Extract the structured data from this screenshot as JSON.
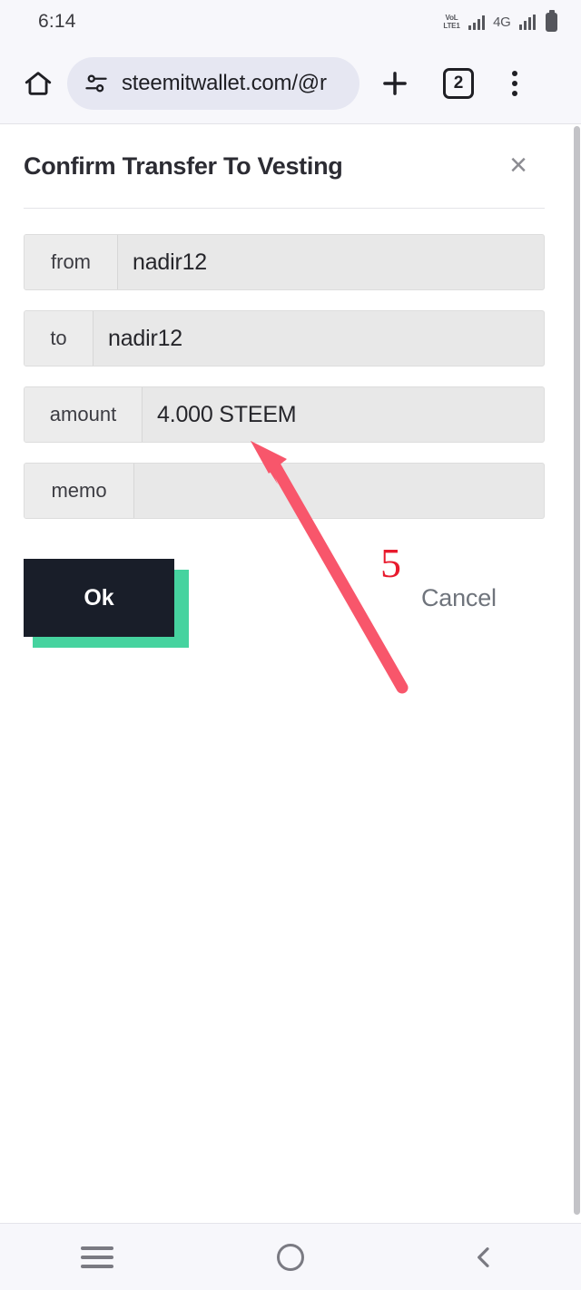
{
  "status_bar": {
    "time": "6:14",
    "volte_line1": "VoL",
    "volte_line2": "LTE1",
    "network": "4G"
  },
  "browser": {
    "url": "steemitwallet.com/@r",
    "tab_count": "2"
  },
  "dialog": {
    "title": "Confirm Transfer To Vesting",
    "close_label": "×",
    "fields": [
      {
        "label": "from",
        "value": "nadir12"
      },
      {
        "label": "to",
        "value": "nadir12"
      },
      {
        "label": "amount",
        "value": "4.000 STEEM"
      },
      {
        "label": "memo",
        "value": ""
      }
    ],
    "ok_label": "Ok",
    "cancel_label": "Cancel"
  },
  "annotation": {
    "step_number": "5",
    "arrow_color": "#f8566b",
    "number_color": "#e81a2d",
    "points_at": "amount"
  },
  "theme": {
    "accent_green": "#46d39f",
    "button_dark": "#191e29",
    "field_bg": "#e8e8e8",
    "chrome_bg": "#f7f7fb",
    "url_pill_bg": "#e6e7f2"
  },
  "nav_bar": {
    "recents": "recents",
    "home": "home",
    "back": "back"
  }
}
